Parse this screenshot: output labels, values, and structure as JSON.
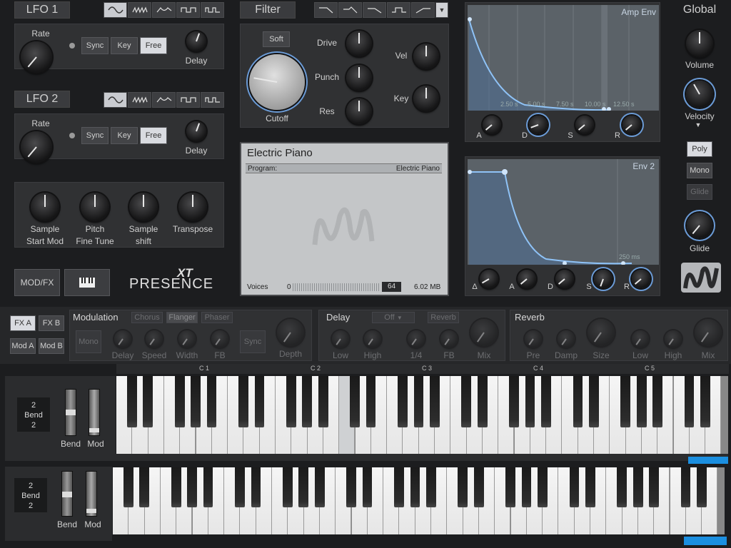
{
  "lfo1": {
    "title": "LFO 1",
    "rate": "Rate",
    "sync": "Sync",
    "key": "Key",
    "free": "Free",
    "delay": "Delay"
  },
  "lfo2": {
    "title": "LFO 2",
    "rate": "Rate",
    "sync": "Sync",
    "key": "Key",
    "free": "Free",
    "delay": "Delay"
  },
  "misc": {
    "k1a": "Sample",
    "k1b": "Start Mod",
    "k2a": "Pitch",
    "k2b": "Fine Tune",
    "k3a": "Sample",
    "k3b": "shift",
    "k4a": "Transpose"
  },
  "bottom_left": {
    "modfx": "MOD/FX",
    "logo": "PRESENCE",
    "logo_xt": "XT"
  },
  "filter": {
    "title": "Filter",
    "soft": "Soft",
    "drive": "Drive",
    "punch": "Punch",
    "res": "Res",
    "vel": "Vel",
    "key": "Key",
    "cutoff": "Cutoff"
  },
  "display": {
    "title": "Electric Piano",
    "program_label": "Program:",
    "program_value": "Electric Piano",
    "voices_label": "Voices",
    "voices_min": "0",
    "voices_value": "64",
    "size": "6.02 MB"
  },
  "amp_env": {
    "title": "Amp Env",
    "t1": "2.50 s",
    "t2": "5.00 s",
    "t3": "7.50 s",
    "t4": "10.00 s",
    "t5": "12.50 s",
    "a": "A",
    "d": "D",
    "s": "S",
    "r": "R"
  },
  "env2": {
    "title": "Env 2",
    "t1": "250 ms",
    "delta": "Δ",
    "a": "A",
    "d": "D",
    "s": "S",
    "r": "R"
  },
  "global": {
    "title": "Global",
    "volume": "Volume",
    "velocity": "Velocity",
    "poly": "Poly",
    "mono": "Mono",
    "glide_btn": "Glide",
    "glide": "Glide"
  },
  "fx": {
    "fxa": "FX A",
    "fxb": "FX B",
    "moda": "Mod A",
    "modb": "Mod B",
    "modulation": {
      "title": "Modulation",
      "chorus": "Chorus",
      "flanger": "Flanger",
      "phaser": "Phaser",
      "mono": "Mono",
      "delay": "Delay",
      "speed": "Speed",
      "width": "Width",
      "fb": "FB",
      "sync": "Sync",
      "depth": "Depth"
    },
    "delay": {
      "title": "Delay",
      "mode": "Off",
      "reverb": "Reverb",
      "low": "Low",
      "high": "High",
      "div": "1/4",
      "fb": "FB",
      "mix": "Mix"
    },
    "reverb": {
      "title": "Reverb",
      "pre": "Pre",
      "damp": "Damp",
      "size": "Size",
      "low": "Low",
      "high": "High",
      "mix": "Mix"
    }
  },
  "keyboard": {
    "c1": "C 1",
    "c2": "C 2",
    "c3": "C 3",
    "c4": "C 4",
    "c5": "C 5",
    "bend_top": "2",
    "bend_label": "Bend",
    "bend_bottom": "2",
    "bend": "Bend",
    "mod": "Mod"
  },
  "keyboard2": {
    "bend_top": "2",
    "bend_label": "Bend",
    "bend_bottom": "2",
    "bend": "Bend",
    "mod": "Mod"
  }
}
